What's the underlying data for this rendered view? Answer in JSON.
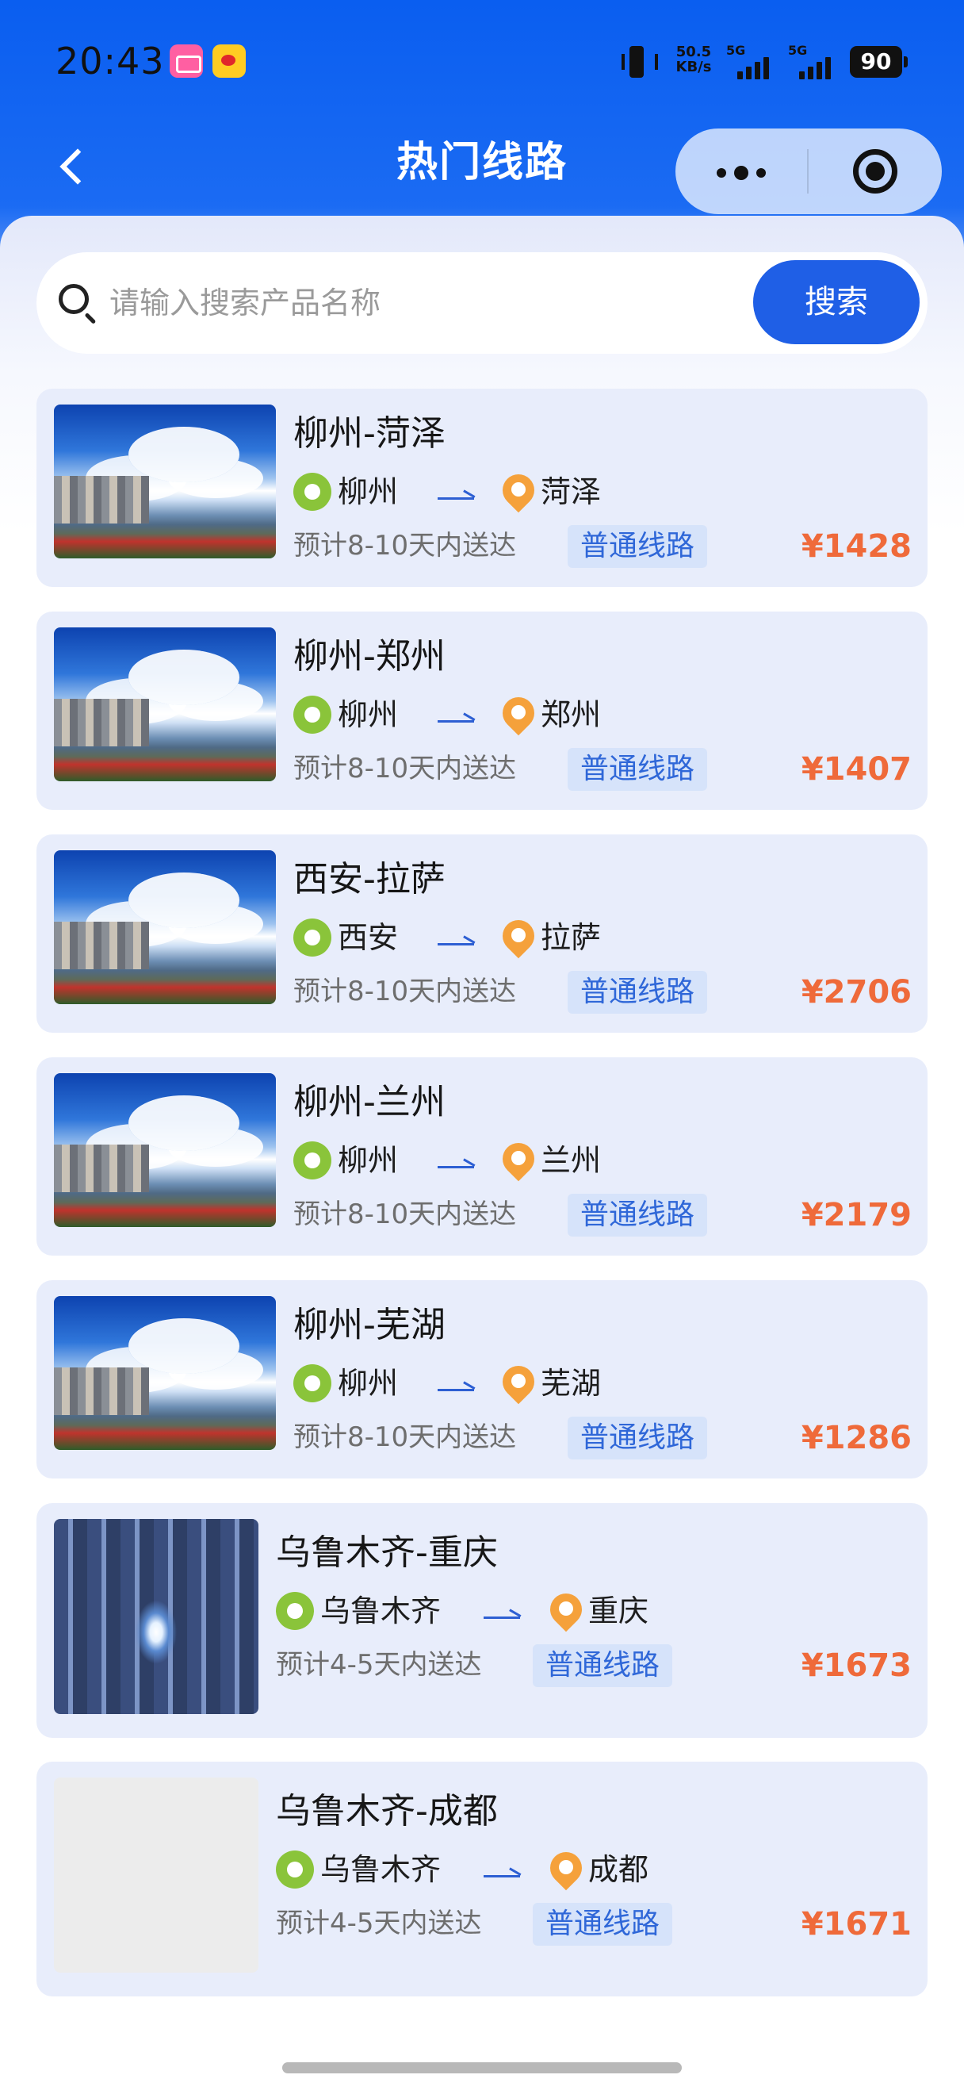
{
  "status_bar": {
    "time": "20:43",
    "net_speed_value": "50.5",
    "net_speed_unit": "KB/s",
    "signal_1": "5G",
    "signal_2": "5G",
    "battery": "90",
    "icons": [
      "bilibili-icon",
      "weibo-icon",
      "vibrate-icon",
      "signal-icon",
      "battery-icon"
    ]
  },
  "nav": {
    "title": "热门线路",
    "icons": [
      "back-arrow-icon",
      "more-dots-icon",
      "close-target-icon"
    ]
  },
  "search": {
    "placeholder": "请输入搜索产品名称",
    "value": "",
    "button_label": "搜索"
  },
  "colors": {
    "header_blue": "#0a5ef0",
    "search_button": "#1f5fe6",
    "card_background": "#e8edfb",
    "price": "#ef6a3a",
    "tag_text": "#2f67d8",
    "origin_icon": "#8ac43a",
    "destination_icon": "#f5a13b"
  },
  "routes": [
    {
      "title": "柳州-菏泽",
      "origin": "柳州",
      "destination": "菏泽",
      "delivery": "预计8-10天内送达",
      "tag": "普通线路",
      "price": "¥1428",
      "image": "city-skyline"
    },
    {
      "title": "柳州-郑州",
      "origin": "柳州",
      "destination": "郑州",
      "delivery": "预计8-10天内送达",
      "tag": "普通线路",
      "price": "¥1407",
      "image": "city-skyline"
    },
    {
      "title": "西安-拉萨",
      "origin": "西安",
      "destination": "拉萨",
      "delivery": "预计8-10天内送达",
      "tag": "普通线路",
      "price": "¥2706",
      "image": "city-skyline"
    },
    {
      "title": "柳州-兰州",
      "origin": "柳州",
      "destination": "兰州",
      "delivery": "预计8-10天内送达",
      "tag": "普通线路",
      "price": "¥2179",
      "image": "city-skyline"
    },
    {
      "title": "柳州-芜湖",
      "origin": "柳州",
      "destination": "芜湖",
      "delivery": "预计8-10天内送达",
      "tag": "普通线路",
      "price": "¥1286",
      "image": "city-skyline"
    },
    {
      "title": "乌鲁木齐-重庆",
      "origin": "乌鲁木齐",
      "destination": "重庆",
      "delivery": "预计4-5天内送达",
      "tag": "普通线路",
      "price": "¥1673",
      "image": "container-tunnel"
    },
    {
      "title": "乌鲁木齐-成都",
      "origin": "乌鲁木齐",
      "destination": "成都",
      "delivery": "预计4-5天内送达",
      "tag": "普通线路",
      "price": "¥1671",
      "image": "placeholder"
    }
  ]
}
